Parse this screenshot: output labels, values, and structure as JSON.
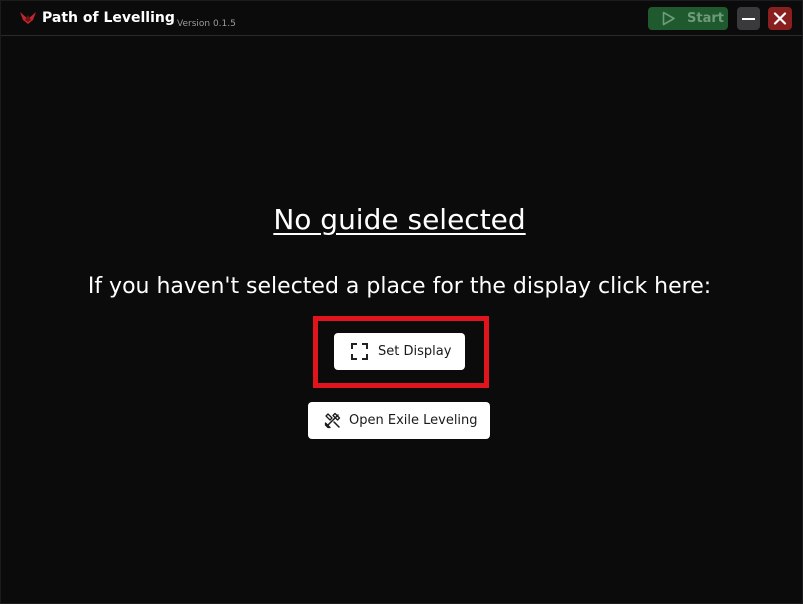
{
  "window": {
    "app_title": "Path of Levelling",
    "version": "Version 0.1.5",
    "logo_icon": "app-logo-icon",
    "start_label": "Start",
    "start_icon": "play-icon",
    "minimize_icon": "minimize-icon",
    "close_icon": "close-icon",
    "colors": {
      "background": "#0b0b0c",
      "start_bg": "#1f5a2e",
      "start_text": "#6f9b7b",
      "close_bg": "#8a1f1f",
      "minimize_bg": "#3a3a3c",
      "highlight": "#e0141c",
      "logo": "#c0272d"
    }
  },
  "main": {
    "heading": "No guide selected",
    "instruction": "If you haven't selected a place for the display click here:",
    "set_display_label": "Set Display",
    "set_display_icon": "dashed-square-icon",
    "open_exile_label": "Open Exile Leveling",
    "open_exile_icon": "tools-icon"
  }
}
